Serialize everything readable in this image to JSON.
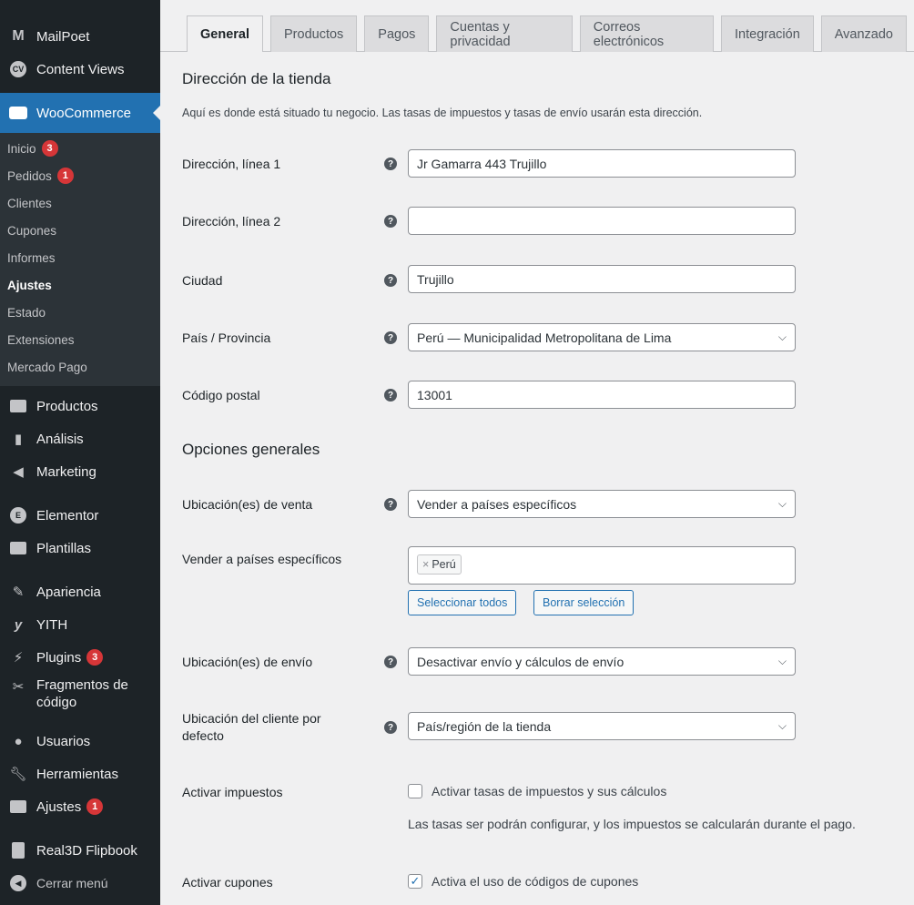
{
  "sidebar": {
    "items": [
      {
        "label": "MailPoet",
        "icon": "mailpoet-icon"
      },
      {
        "label": "Content Views",
        "icon": "content-views-icon"
      },
      {
        "label": "WooCommerce",
        "icon": "woocommerce-icon"
      },
      {
        "label": "Productos",
        "icon": "products-icon"
      },
      {
        "label": "Análisis",
        "icon": "analytics-icon"
      },
      {
        "label": "Marketing",
        "icon": "megaphone-icon"
      },
      {
        "label": "Elementor",
        "icon": "elementor-icon"
      },
      {
        "label": "Plantillas",
        "icon": "folder-icon"
      },
      {
        "label": "Apariencia",
        "icon": "brush-icon"
      },
      {
        "label": "YITH",
        "icon": "yith-icon"
      },
      {
        "label": "Plugins",
        "icon": "plugin-icon",
        "badge": "3"
      },
      {
        "label": "Fragmentos de código",
        "icon": "scissors-icon"
      },
      {
        "label": "Usuarios",
        "icon": "users-icon"
      },
      {
        "label": "Herramientas",
        "icon": "wrench-icon"
      },
      {
        "label": "Ajustes",
        "icon": "settings-icon",
        "badge": "1"
      },
      {
        "label": "Real3D Flipbook",
        "icon": "book-icon"
      },
      {
        "label": "Cerrar menú",
        "icon": "collapse-icon"
      }
    ],
    "submenu": [
      {
        "label": "Inicio",
        "badge": "3"
      },
      {
        "label": "Pedidos",
        "badge": "1"
      },
      {
        "label": "Clientes"
      },
      {
        "label": "Cupones"
      },
      {
        "label": "Informes"
      },
      {
        "label": "Ajustes"
      },
      {
        "label": "Estado"
      },
      {
        "label": "Extensiones"
      },
      {
        "label": "Mercado Pago"
      }
    ]
  },
  "tabs": [
    "General",
    "Productos",
    "Pagos",
    "Cuentas y privacidad",
    "Correos electrónicos",
    "Integración",
    "Avanzado"
  ],
  "store_address": {
    "heading": "Dirección de la tienda",
    "description": "Aquí es donde está situado tu negocio. Las tasas de impuestos y tasas de envío usarán esta dirección.",
    "address1": {
      "label": "Dirección, línea 1",
      "value": "Jr Gamarra 443 Trujillo"
    },
    "address2": {
      "label": "Dirección, línea 2",
      "value": ""
    },
    "city": {
      "label": "Ciudad",
      "value": "Trujillo"
    },
    "country": {
      "label": "País / Provincia",
      "value": "Perú — Municipalidad Metropolitana de Lima"
    },
    "postcode": {
      "label": "Código postal",
      "value": "13001"
    }
  },
  "general_options": {
    "heading": "Opciones generales",
    "selling_locations": {
      "label": "Ubicación(es) de venta",
      "value": "Vender a países específicos"
    },
    "specific_countries": {
      "label": "Vender a países específicos",
      "tag": "Perú",
      "select_all": "Seleccionar todos",
      "clear": "Borrar selección"
    },
    "shipping_locations": {
      "label": "Ubicación(es) de envío",
      "value": "Desactivar envío y cálculos de envío"
    },
    "default_customer_location": {
      "label": "Ubicación del cliente por defecto",
      "value": "País/región de la tienda"
    },
    "enable_taxes": {
      "label": "Activar impuestos",
      "checkbox_label": "Activar tasas de impuestos y sus cálculos",
      "checked": false,
      "note": "Las tasas ser podrán configurar, y los impuestos se calcularán durante el pago."
    },
    "enable_coupons": {
      "label": "Activar cupones",
      "checkbox_label": "Activa el uso de códigos de cupones",
      "checked": true
    }
  }
}
